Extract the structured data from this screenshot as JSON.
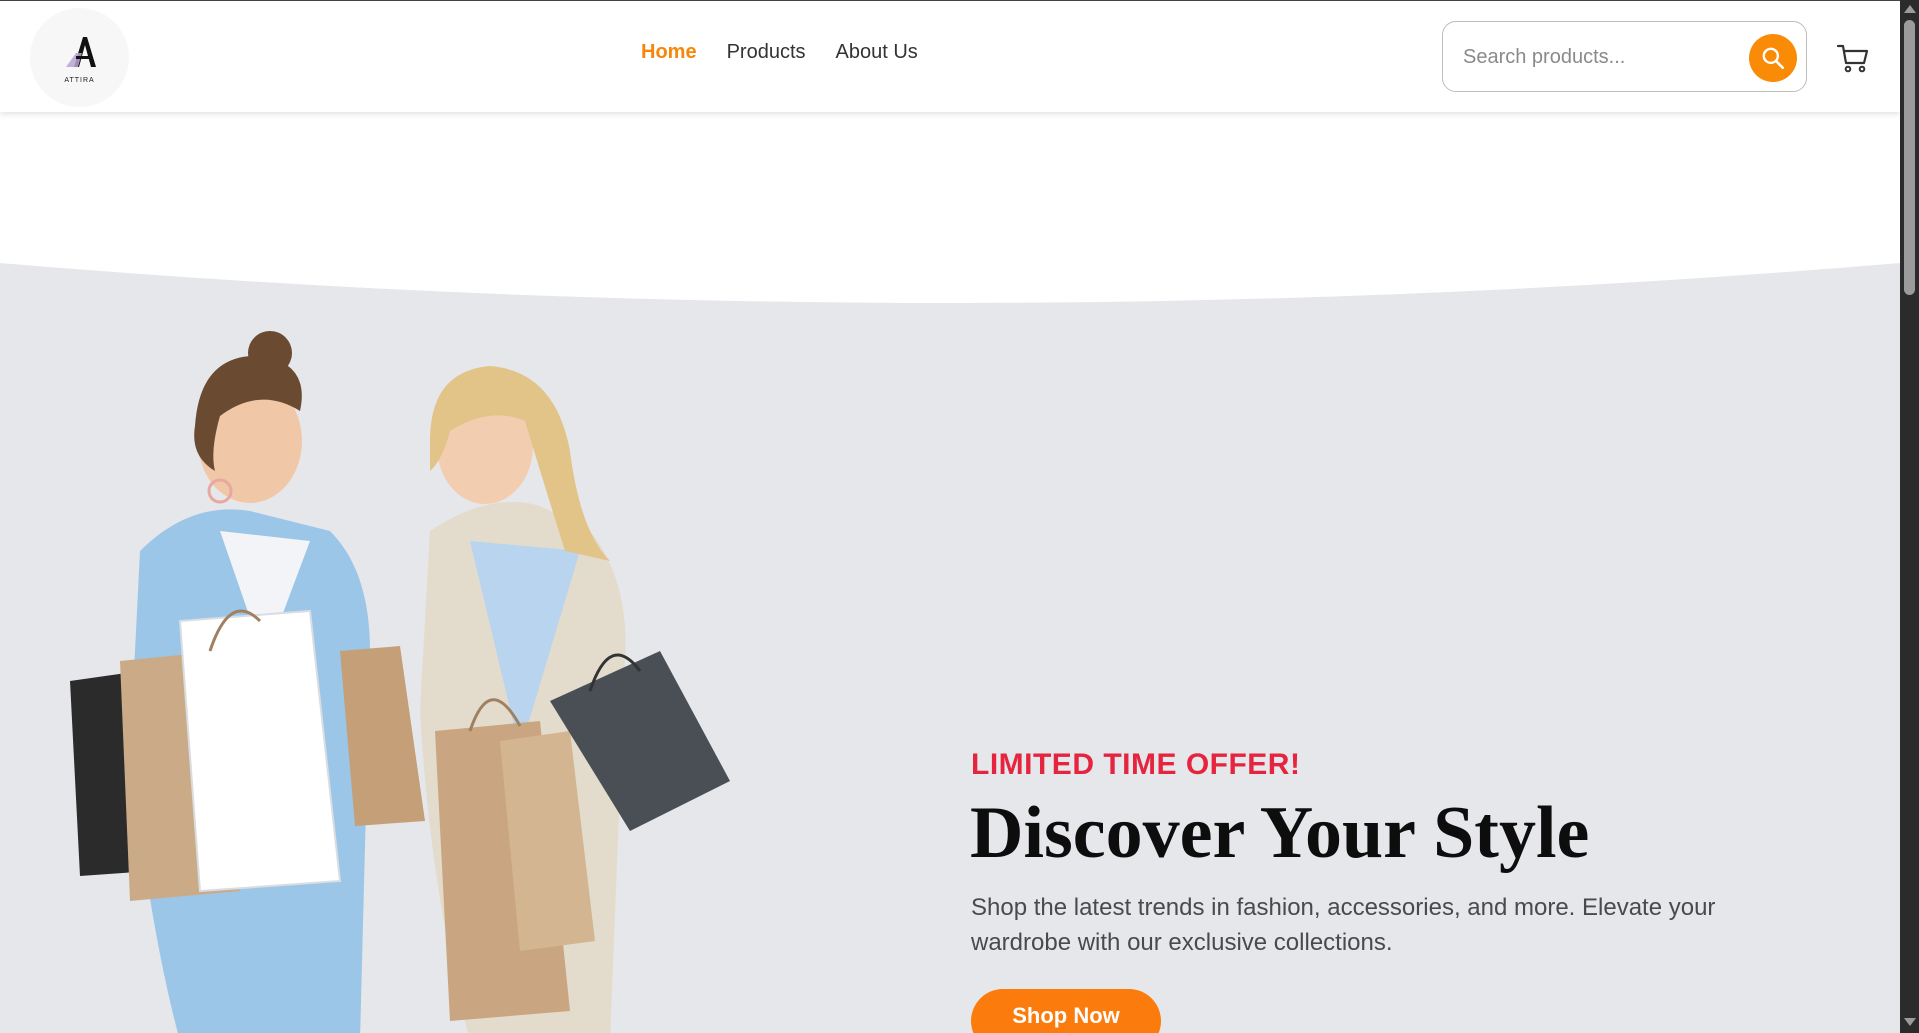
{
  "brand": {
    "name": "ATTIRA"
  },
  "nav": {
    "items": [
      {
        "label": "Home",
        "active": true
      },
      {
        "label": "Products",
        "active": false
      },
      {
        "label": "About Us",
        "active": false
      }
    ]
  },
  "search": {
    "placeholder": "Search products...",
    "value": ""
  },
  "hero": {
    "offer": "LIMITED TIME OFFER!",
    "title": "Discover Your Style",
    "description": "Shop the latest trends in fashion, accessories, and more. Elevate your wardrobe with our exclusive collections.",
    "cta": "Shop Now"
  },
  "colors": {
    "accent": "#f98b06",
    "offer_red": "#e5253f",
    "hero_bg": "#e6e7eb",
    "active_nav": "#f7870a"
  },
  "icons": {
    "search": "search-icon",
    "cart": "cart-icon"
  }
}
